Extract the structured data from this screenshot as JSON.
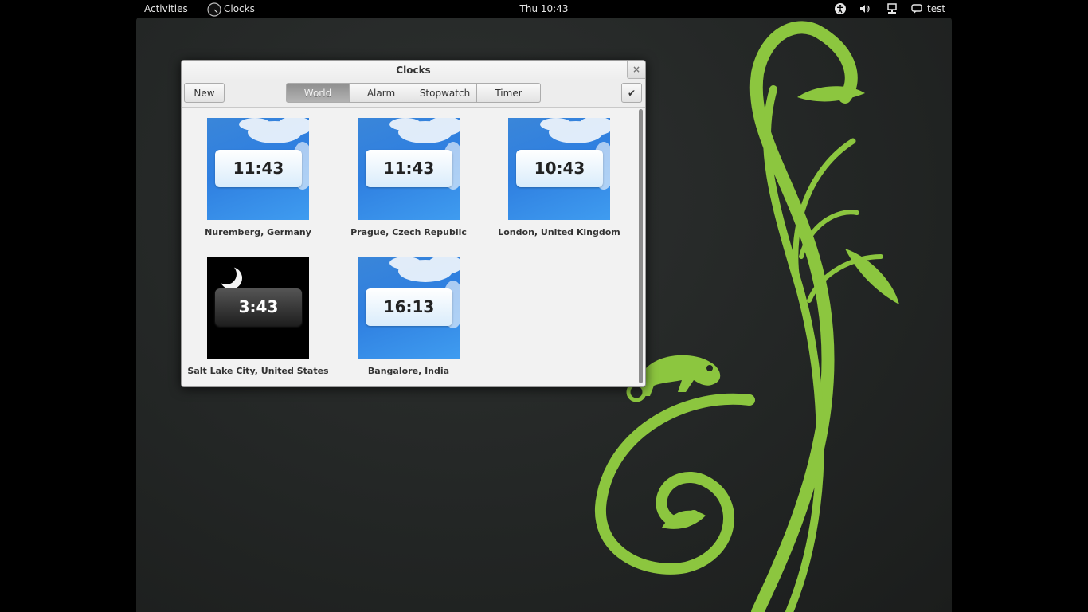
{
  "top_bar": {
    "activities": "Activities",
    "app_name": "Clocks",
    "clock": "Thu 10:43",
    "user": "test"
  },
  "window": {
    "title": "Clocks",
    "close_symbol": "×",
    "new_label": "New",
    "done_symbol": "✔",
    "tabs": [
      "World",
      "Alarm",
      "Stopwatch",
      "Timer"
    ],
    "active_tab": "World"
  },
  "clocks": [
    {
      "time": "11:43",
      "city": "Nuremberg, Germany",
      "theme": "day"
    },
    {
      "time": "11:43",
      "city": "Prague, Czech Republic",
      "theme": "day"
    },
    {
      "time": "10:43",
      "city": "London, United Kingdom",
      "theme": "day"
    },
    {
      "time": "3:43",
      "city": "Salt Lake City, United States",
      "theme": "night"
    },
    {
      "time": "16:13",
      "city": "Bangalore, India",
      "theme": "day"
    }
  ],
  "colors": {
    "wallpaper_green": "#8cc63f",
    "sky_blue": "#2f7fe0"
  },
  "icons": {
    "app_menu": "clocks-app-icon",
    "a11y": "accessibility-icon",
    "volume": "volume-icon",
    "network": "network-icon",
    "user": "user-chat-icon"
  }
}
